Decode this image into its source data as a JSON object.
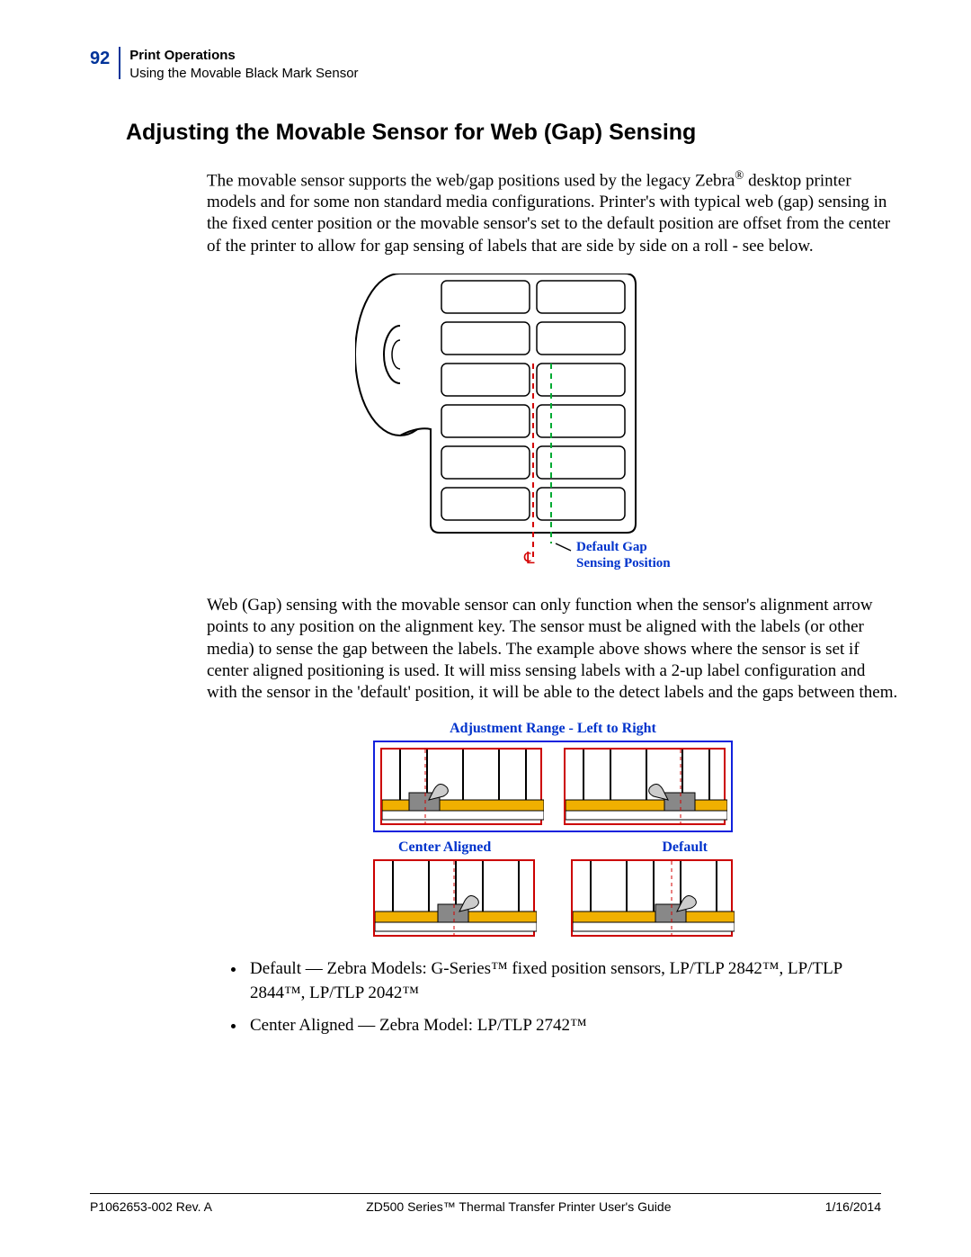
{
  "header": {
    "page_number": "92",
    "section_title": "Print Operations",
    "subsection": "Using the Movable Black Mark Sensor"
  },
  "heading": "Adjusting the Movable Sensor for Web (Gap) Sensing",
  "paragraph1_a": "The movable sensor supports the web/gap positions used by the legacy Zebra",
  "paragraph1_sup": "®",
  "paragraph1_b": " desktop printer models and for some non standard media configurations. Printer's with typical web (gap) sensing in the fixed center position or the movable sensor's set to the default position are offset from the center of the printer to allow for gap sensing of labels that are side by side on a roll - see below.",
  "figure1": {
    "callout_line1": "Default Gap",
    "callout_line2": "Sensing Position",
    "center_symbol": "℄"
  },
  "paragraph2": "Web (Gap) sensing with the movable sensor can only function when the sensor's alignment arrow points to any position on the alignment key. The sensor must be aligned with the labels (or other media) to sense the gap between the labels. The example above shows where the sensor is set if center aligned positioning is used. It will miss sensing labels with a 2-up label configuration and with the sensor in the 'default' position, it will be able to the detect labels and the gaps between them.",
  "figure2": {
    "top_caption": "Adjustment Range - Left to Right",
    "cap_left": "Center Aligned",
    "cap_right": "Default"
  },
  "bullets": [
    "Default — Zebra Models: G-Series™ fixed position sensors, LP/TLP 2842™, LP/TLP 2844™, LP/TLP 2042™",
    "Center Aligned — Zebra Model: LP/TLP 2742™"
  ],
  "footer": {
    "left": "P1062653-002 Rev. A",
    "center": "ZD500 Series™ Thermal Transfer Printer User's Guide",
    "right": "1/16/2014"
  }
}
